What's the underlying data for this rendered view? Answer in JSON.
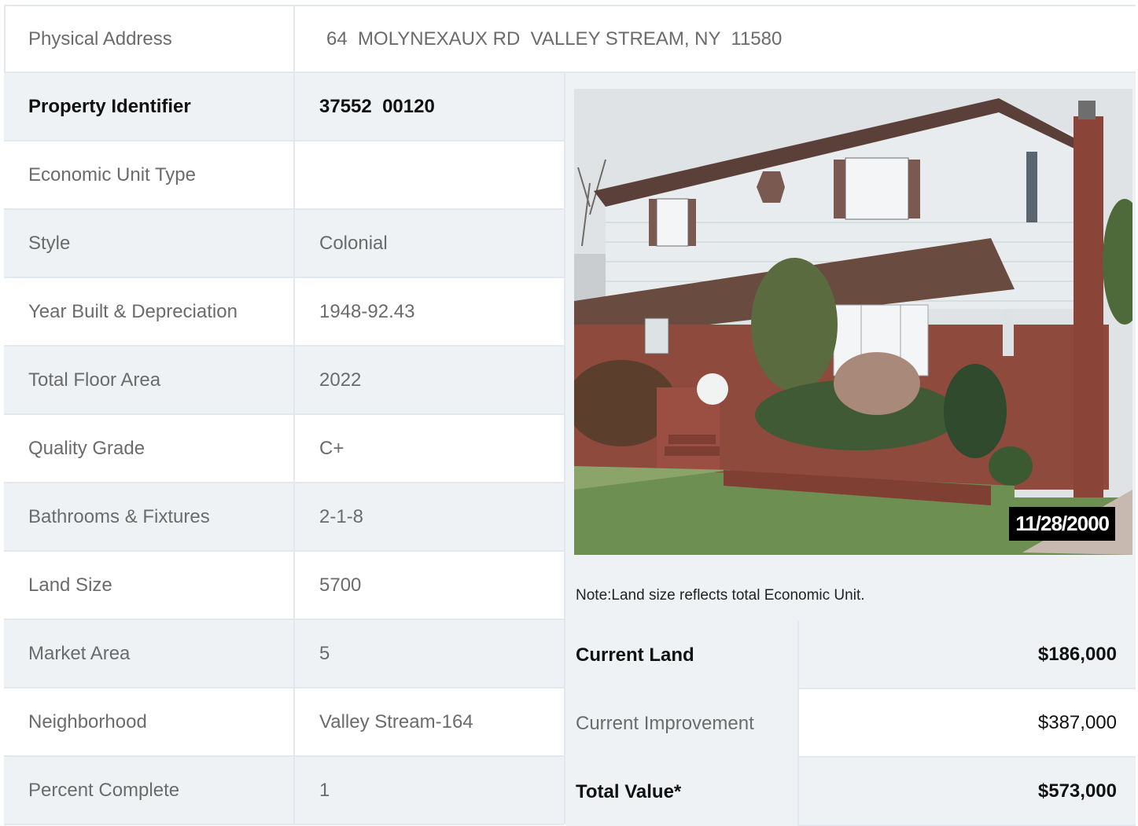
{
  "address": {
    "label": "Physical Address",
    "value": "64  MOLYNEXAUX RD  VALLEY STREAM, NY  11580"
  },
  "property_rows": [
    {
      "label": "Property Identifier",
      "value": "37552  00120"
    },
    {
      "label": "Economic Unit Type",
      "value": ""
    },
    {
      "label": "Style",
      "value": "Colonial"
    },
    {
      "label": "Year Built & Depreciation",
      "value": "1948-92.43"
    },
    {
      "label": "Total Floor Area",
      "value": "2022"
    },
    {
      "label": "Quality Grade",
      "value": "C+"
    },
    {
      "label": "Bathrooms & Fixtures",
      "value": "2-1-8"
    },
    {
      "label": "Land Size",
      "value": "5700"
    },
    {
      "label": "Market Area",
      "value": "5"
    },
    {
      "label": "Neighborhood",
      "value": "Valley Stream-164"
    },
    {
      "label": "Percent Complete",
      "value": "1"
    }
  ],
  "photo": {
    "date_stamp": "11/28/2000"
  },
  "note": "Note:Land size reflects total Economic Unit.",
  "values": [
    {
      "label": "Current Land",
      "value": "$186,000"
    },
    {
      "label": "Current Improvement",
      "value": "$387,000"
    },
    {
      "label": "Total Value*",
      "value": "$573,000"
    }
  ],
  "colors": {
    "row_shade": "#eff2f5",
    "border": "#e3e8ee",
    "text_muted": "#6b6b6b",
    "text_bold": "#111111"
  }
}
